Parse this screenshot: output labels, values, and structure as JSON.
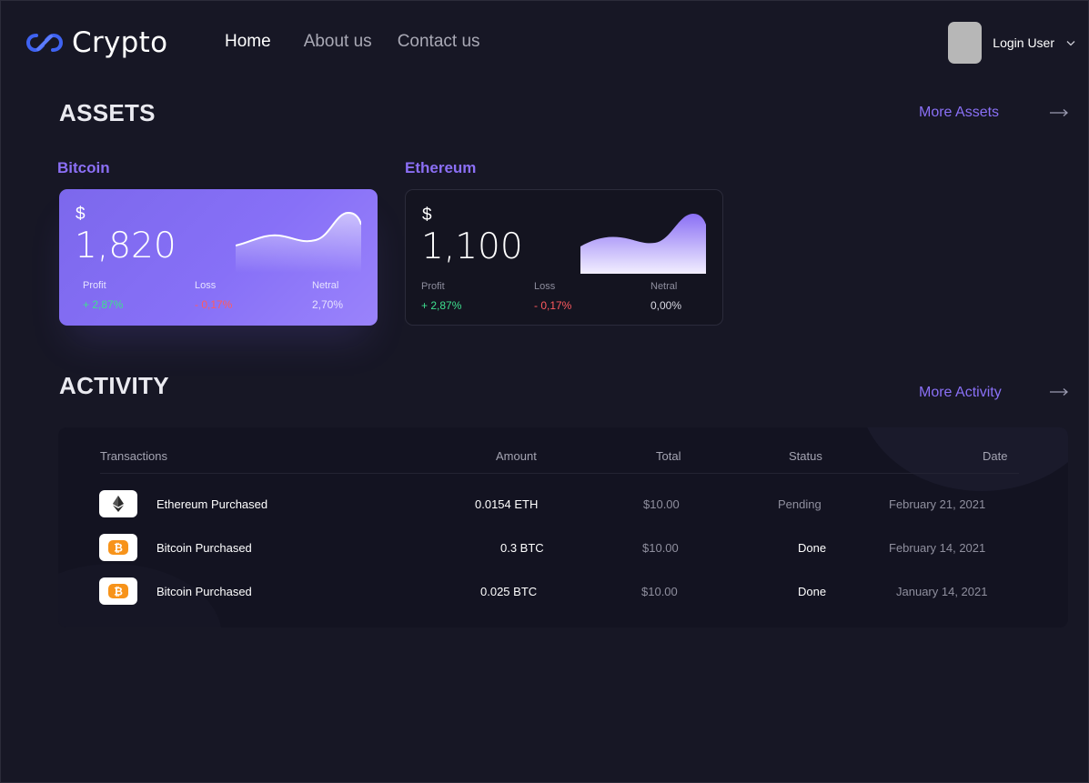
{
  "brand": {
    "name": "Crypto",
    "icon": "infinity-link-icon",
    "accent": "#4f6ef7"
  },
  "nav": {
    "home": "Home",
    "about": "About us",
    "contact": "Contact us"
  },
  "user": {
    "name": "Login User",
    "avatar": "avatar-placeholder",
    "menu_icon": "chevron-down-icon"
  },
  "assets": {
    "title": "ASSETS",
    "more_label": "More Assets",
    "more_icon": "arrow-right-icon",
    "cards": [
      {
        "coin": "Bitcoin",
        "currency": "$",
        "amount": "1,820",
        "profit_label": "Profit",
        "profit_value": "+ 2,87%",
        "loss_label": "Loss",
        "loss_value": "- 0,17%",
        "neutral_label": "Netral",
        "neutral_value": "2,70%",
        "style": "purple"
      },
      {
        "coin": "Ethereum",
        "currency": "$",
        "amount": "1,100",
        "profit_label": "Profit",
        "profit_value": "+ 2,87%",
        "loss_label": "Loss",
        "loss_value": "- 0,17%",
        "neutral_label": "Netral",
        "neutral_value": "0,00%",
        "style": "dark"
      }
    ]
  },
  "activity": {
    "title": "ACTIVITY",
    "more_label": "More Activity",
    "more_icon": "arrow-right-icon",
    "columns": [
      "Transactions",
      "Amount",
      "Total",
      "Status",
      "Date"
    ],
    "rows": [
      {
        "icon": "ethereum-icon",
        "name": "Ethereum Purchased",
        "amount": "0.0154 ETH",
        "total": "$10.00",
        "status": "Pending",
        "date": "February 21, 2021"
      },
      {
        "icon": "bitcoin-icon",
        "name": "Bitcoin Purchased",
        "amount": "0.3 BTC",
        "total": "$10.00",
        "status": "Done",
        "date": "February 14, 2021"
      },
      {
        "icon": "bitcoin-icon",
        "name": "Bitcoin Purchased",
        "amount": "0.025 BTC",
        "total": "$10.00",
        "status": "Done",
        "date": "January 14, 2021"
      }
    ]
  },
  "colors": {
    "background": "#171725",
    "accent_purple": "#8b6ff5",
    "profit_green": "#3ee08f",
    "loss_red": "#ff5a5f",
    "bitcoin_orange": "#f7931a"
  }
}
